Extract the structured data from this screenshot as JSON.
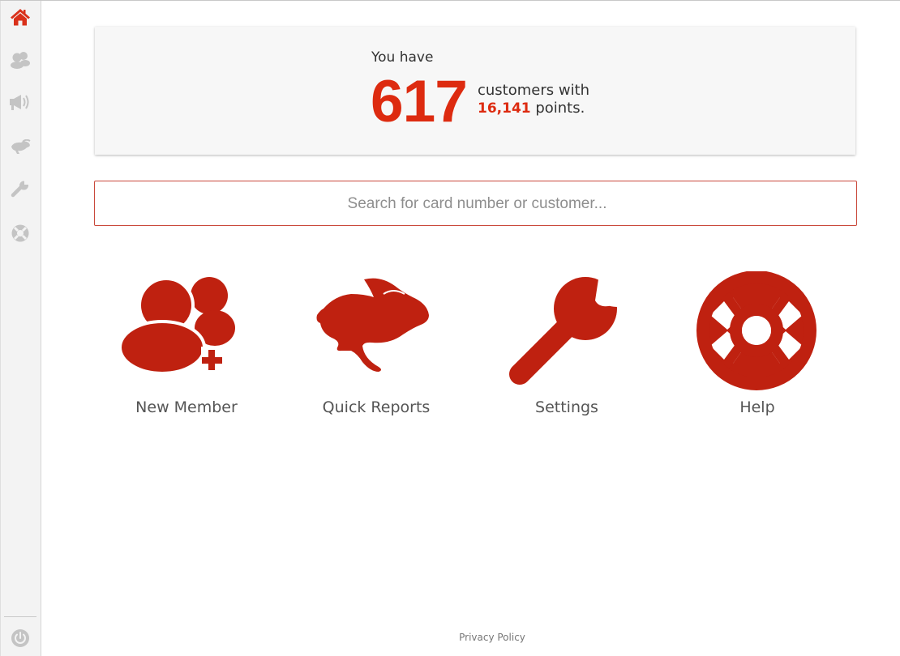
{
  "sidebar": {
    "items": [
      {
        "name": "home-icon",
        "active": true
      },
      {
        "name": "members-icon",
        "active": false
      },
      {
        "name": "megaphone-icon",
        "active": false
      },
      {
        "name": "rabbit-icon",
        "active": false
      },
      {
        "name": "wrench-icon",
        "active": false
      },
      {
        "name": "lifebuoy-icon",
        "active": false
      }
    ],
    "bottom_item": {
      "name": "power-icon"
    }
  },
  "stats": {
    "prefix": "You have",
    "customer_count": "617",
    "customers_text": "customers with",
    "points": "16,141",
    "points_suffix": " points."
  },
  "search": {
    "placeholder": "Search for card number or customer..."
  },
  "tiles": [
    {
      "label": "New Member",
      "icon": "add-member-icon"
    },
    {
      "label": "Quick Reports",
      "icon": "rabbit-icon"
    },
    {
      "label": "Settings",
      "icon": "wrench-icon"
    },
    {
      "label": "Help",
      "icon": "lifebuoy-icon"
    }
  ],
  "footer": {
    "privacy_label": "Privacy Policy"
  },
  "colors": {
    "accent": "#dd2b10",
    "icon_red": "#bf2110",
    "sidebar_icon_gray": "#c4c4c4"
  }
}
